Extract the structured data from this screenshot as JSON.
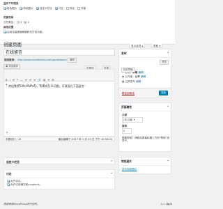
{
  "screen_options": {
    "boxes_heading": "显示下列项目",
    "boxes": [
      {
        "label": "特色图片",
        "checked": true
      },
      {
        "label": "特色图片",
        "checked": true
      },
      {
        "label": "自定义栏目",
        "checked": true
      },
      {
        "label": "讨论",
        "checked": true
      },
      {
        "label": "别名",
        "checked": false
      },
      {
        "label": "作者",
        "checked": false
      }
    ],
    "layout_heading": "页面布局",
    "columns_label": "分栏数目：",
    "columns_options": [
      "1",
      "2"
    ],
    "columns_selected": "2",
    "additional_heading": "其他设置",
    "fullheight_label": "启用全高度编辑器和无打扰功能。"
  },
  "page": {
    "heading": "创建页面",
    "screen_options_tab": "显示选项",
    "help_tab": "帮助"
  },
  "editor": {
    "title": "在线留言",
    "permalink_label": "固定链接：",
    "permalink_url": "http://www.excelfamily.com/guestbook/",
    "permalink_edit": "编辑",
    "add_media": "添加媒体",
    "tab_visual": "可视化",
    "tab_text": "文本",
    "toolbar_row1": [
      "B",
      "I",
      "≡",
      "❝",
      "—",
      "≡",
      "≡",
      "≡",
      "🔗",
      "⊠",
      "≡",
      "⊞"
    ],
    "toolbar_row2": [
      "¶",
      "—",
      "U",
      "≡",
      "A",
      "T",
      "Ω",
      "⇤",
      "⇥",
      "↶",
      "↷",
      "?"
    ],
    "content": "欢迎来到 ExcelFamily，如果有什么问题，可直接在下面留言：",
    "path": "p",
    "word_count": "字数统计：31",
    "last_edit": "最后编辑于 2017 年 1 月 23 日 下午 10:56:04"
  },
  "publish": {
    "title": "发布",
    "save_draft": "保存草稿",
    "preview": "预览",
    "status_label": "状态：",
    "status_value": "草稿",
    "status_edit": "编辑",
    "visibility_label": "公开度：",
    "visibility_value": "公开",
    "visibility_edit": "编辑",
    "schedule_label": "立即发布",
    "schedule_edit": "编辑",
    "trash": "移至回收站",
    "publish_button": "发布"
  },
  "page_attributes": {
    "title": "页面属性",
    "parent_label": "父级",
    "parent_value": "(无父级)",
    "order_label": "排序",
    "order_value": "0",
    "help_text": "需要帮助？请使用屏幕标题上方的\"帮助\"选项卡。"
  },
  "featured_image": {
    "title": "特色图片",
    "link": "设为特色图片"
  },
  "custom_fields": {
    "title": "自定义栏目"
  },
  "discussion": {
    "title": "讨论",
    "allow_comments": "允许评论。",
    "allow_pings": "允许引用通告和pingback。",
    "allow_pings_link": "trackback和pingback"
  },
  "footer": {
    "thanks": "感谢使用WordPress进行创作。",
    "version": "4.7.1版本"
  },
  "colors": {
    "accent": "#0073aa",
    "primary_button": "#0085ba",
    "trash": "#a00",
    "background": "#f1f1f1"
  }
}
